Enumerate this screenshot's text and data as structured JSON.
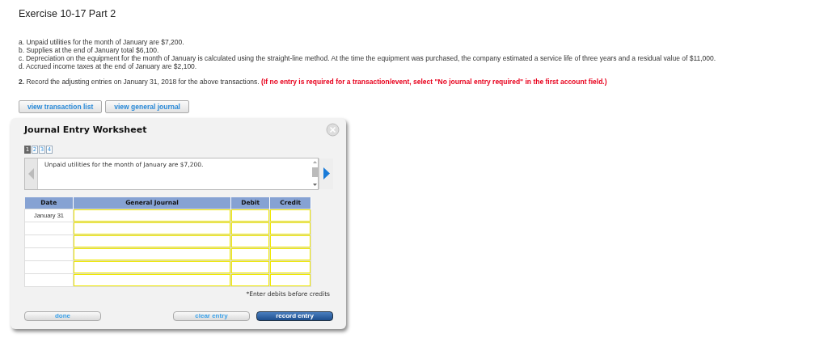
{
  "title": "Exercise 10-17 Part 2",
  "items": [
    "a. Unpaid utilities for the month of January are $7,200.",
    "b. Supplies at the end of January total $6,100.",
    "c. Depreciation on the equipment for the month of January is calculated using the straight-line method. At the time the equipment was purchased, the company estimated a service life of three years and a residual value of $11,000.",
    "d. Accrued income taxes at the end of January are $2,100."
  ],
  "instruction": "**2.** Record the adjusting entries on January 31, 2018 for the above transactions. ",
  "instruction_note": "(If no entry is required for a transaction/event, select \"No journal entry required\" in the first account field.)",
  "top_buttons": [
    "view transaction list",
    "view general journal"
  ],
  "worksheet": {
    "title": "Journal Entry Worksheet",
    "pages": [
      {
        "label": "1",
        "selected": true
      },
      {
        "label": "2",
        "selected": false
      },
      {
        "label": "3",
        "selected": false
      },
      {
        "label": "4",
        "selected": false
      }
    ],
    "description": "Unpaid utilities for the month of January are $7,200.",
    "table": {
      "columns": [
        "Date",
        "General Journal",
        "Debit",
        "Credit"
      ],
      "rows": [
        {
          "date": "January 31"
        },
        {},
        {},
        {},
        {},
        {}
      ]
    },
    "note": "*Enter debits before credits",
    "buttons": [
      {
        "label": "done",
        "kind": "plain"
      },
      {
        "label": "clear entry",
        "kind": "plain"
      },
      {
        "label": "record entry",
        "kind": "primary"
      }
    ]
  }
}
